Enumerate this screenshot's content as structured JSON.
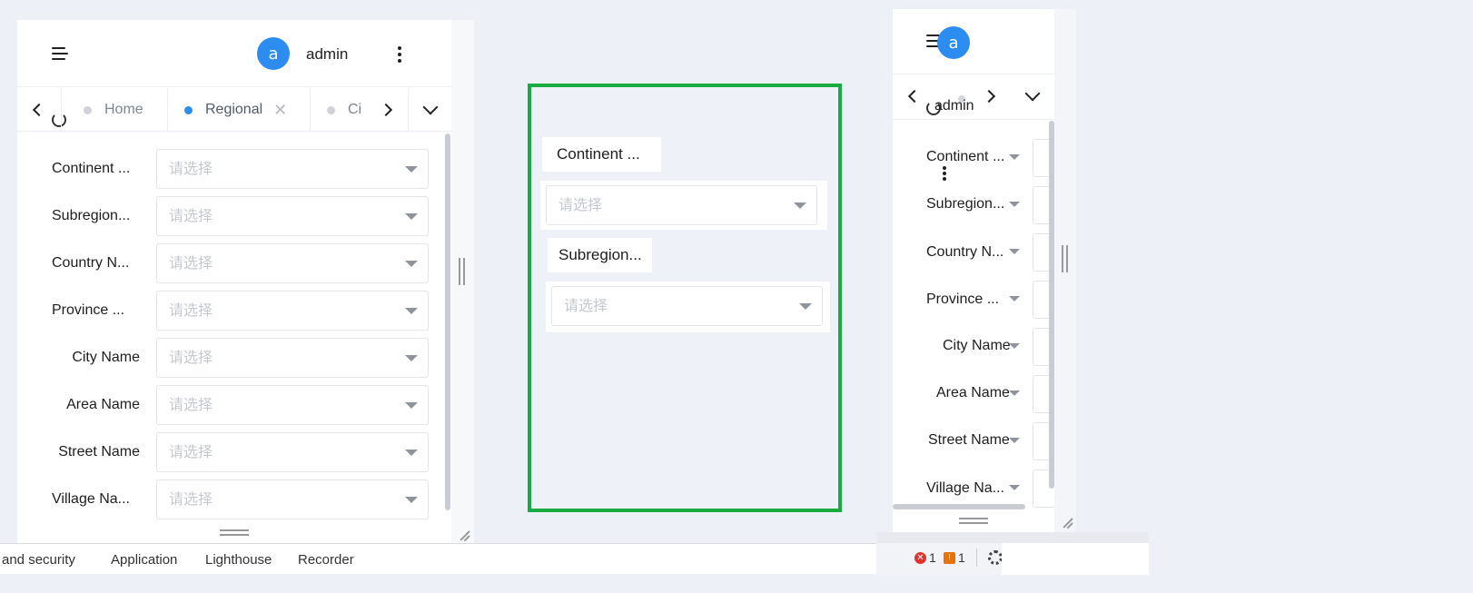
{
  "app": {
    "username": "admin",
    "avatar_letter": "a"
  },
  "tabs": [
    {
      "label": "Home",
      "active": false
    },
    {
      "label": "Regional",
      "active": true,
      "closable": true
    },
    {
      "label": "Ci",
      "active": false
    }
  ],
  "form": {
    "placeholder": "请选择",
    "fields": [
      {
        "label": "Continent ..."
      },
      {
        "label": "Subregion..."
      },
      {
        "label": "Country N..."
      },
      {
        "label": "Province ..."
      },
      {
        "label": "City Name"
      },
      {
        "label": "Area Name"
      },
      {
        "label": "Street Name"
      },
      {
        "label": "Village Na..."
      }
    ]
  },
  "middle": {
    "items": [
      {
        "label": "Continent ...",
        "placeholder": "请选择"
      },
      {
        "label": "Subregion...",
        "placeholder": "请选择"
      }
    ],
    "highlight_color": "#1aaa42"
  },
  "right_panel": {
    "username": "admin",
    "avatar_letter": "a",
    "fields": [
      {
        "label": "Continent ..."
      },
      {
        "label": "Subregion..."
      },
      {
        "label": "Country N..."
      },
      {
        "label": "Province ..."
      },
      {
        "label": "City Name"
      },
      {
        "label": "Area Name"
      },
      {
        "label": "Street Name"
      },
      {
        "label": "Village Na..."
      }
    ]
  },
  "devtools": {
    "tabs": [
      "and security",
      "Application",
      "Lighthouse",
      "Recorder"
    ],
    "error_count": "1",
    "warning_count": "1"
  },
  "colors": {
    "accent": "#2d8cf0",
    "background": "#edf0f7"
  }
}
